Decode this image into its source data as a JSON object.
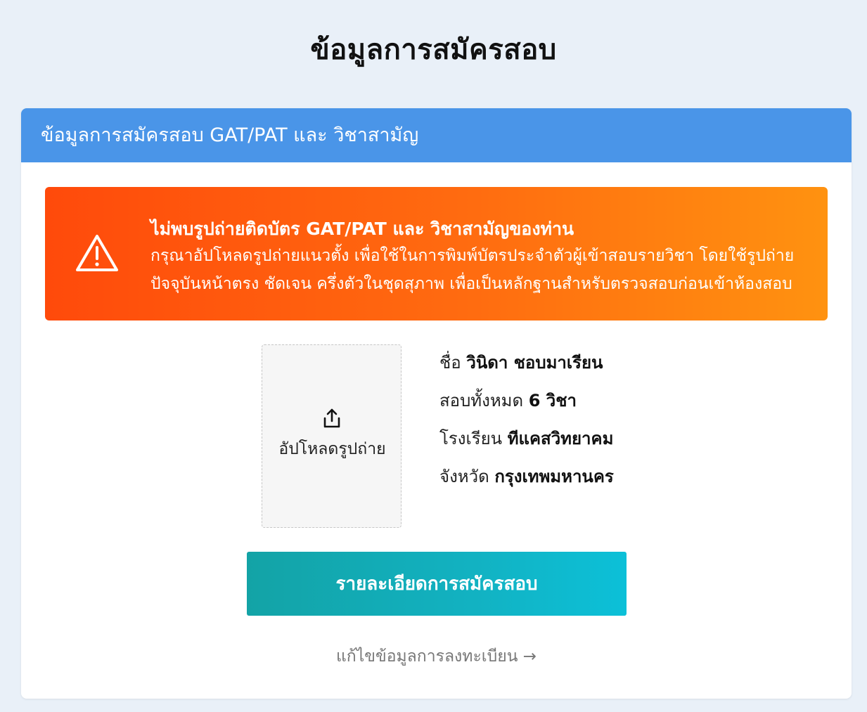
{
  "page": {
    "title": "ข้อมูลการสมัครสอบ"
  },
  "card": {
    "header": "ข้อมูลการสมัครสอบ GAT/PAT และ วิชาสามัญ"
  },
  "alert": {
    "icon": "warning-triangle-icon",
    "title": "ไม่พบรูปถ่ายติดบัตร GAT/PAT และ วิชาสามัญของท่าน",
    "line1": "กรุณาอัปโหลดรูปถ่ายแนวตั้ง เพื่อใช้ในการพิมพ์บัตรประจำตัวผู้เข้าสอบรายวิชา โดยใช้รูปถ่าย",
    "line2": "ปัจจุบันหน้าตรง ชัดเจน ครึ่งตัวในชุดสุภาพ เพื่อเป็นหลักฐานสำหรับตรวจสอบก่อนเข้าห้องสอบ",
    "colors": {
      "start": "#ff4a0b",
      "end": "#ff9210"
    }
  },
  "upload": {
    "icon": "upload-icon",
    "label": "อัปโหลดรูปถ่าย"
  },
  "info": {
    "name_label": "ชื่อ",
    "name_value": "วินิดา ชอบมาเรียน",
    "subjects_label": "สอบทั้งหมด",
    "subjects_value": "6 วิชา",
    "school_label": "โรงเรียน",
    "school_value": "ทีแคสวิทยาคม",
    "province_label": "จังหวัด",
    "province_value": "กรุงเทพมหานคร"
  },
  "actions": {
    "primary_label": "รายละเอียดการสมัครสอบ",
    "edit_link": "แก้ไขข้อมูลการลงทะเบียน →"
  },
  "colors": {
    "header": "#4a95e8",
    "button": "#13a3a6",
    "background": "#e9f0f8"
  }
}
